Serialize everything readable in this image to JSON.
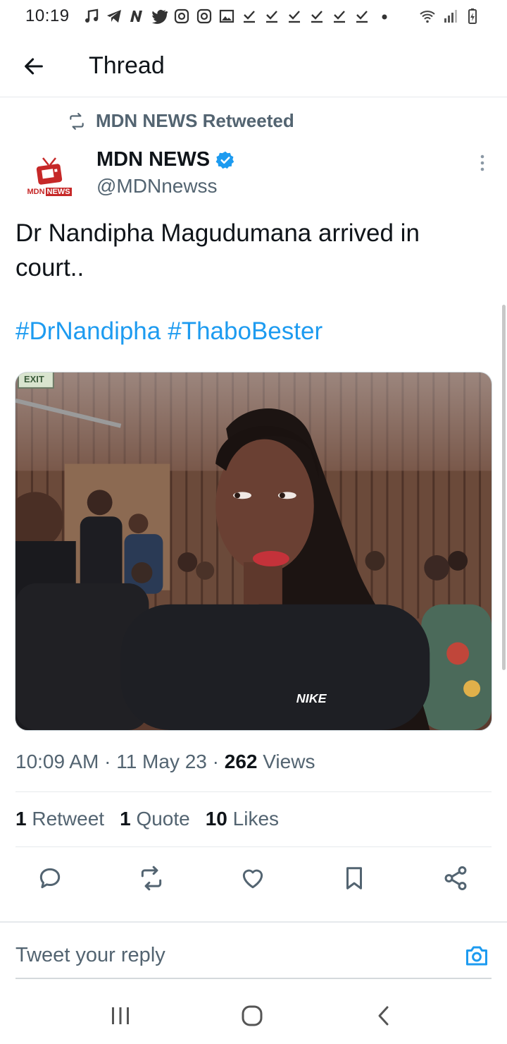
{
  "status_bar": {
    "time": "10:19"
  },
  "header": {
    "title": "Thread"
  },
  "retweet_banner": {
    "text": "MDN NEWS Retweeted"
  },
  "author": {
    "name": "MDN NEWS",
    "handle": "@MDNnewss",
    "avatar_text_left": "MDN",
    "avatar_text_right": "NEWS",
    "verified_color": "#1d9bf0"
  },
  "tweet": {
    "text": "Dr Nandipha Magudumana arrived in court..",
    "hashtags": [
      "#DrNandipha",
      "#ThaboBester"
    ]
  },
  "photo": {
    "exit_sign": "EXIT",
    "shirt_logo": "NIKE"
  },
  "meta": {
    "time": "10:09 AM",
    "separator": "·",
    "date": "11 May 23",
    "views_count": "262",
    "views_label": "Views"
  },
  "stats": {
    "retweets_count": "1",
    "retweets_label": "Retweet",
    "quotes_count": "1",
    "quotes_label": "Quote",
    "likes_count": "10",
    "likes_label": "Likes"
  },
  "reply": {
    "placeholder": "Tweet your reply"
  },
  "colors": {
    "accent": "#1d9bf0",
    "text": "#0f1419",
    "muted": "#536471"
  }
}
